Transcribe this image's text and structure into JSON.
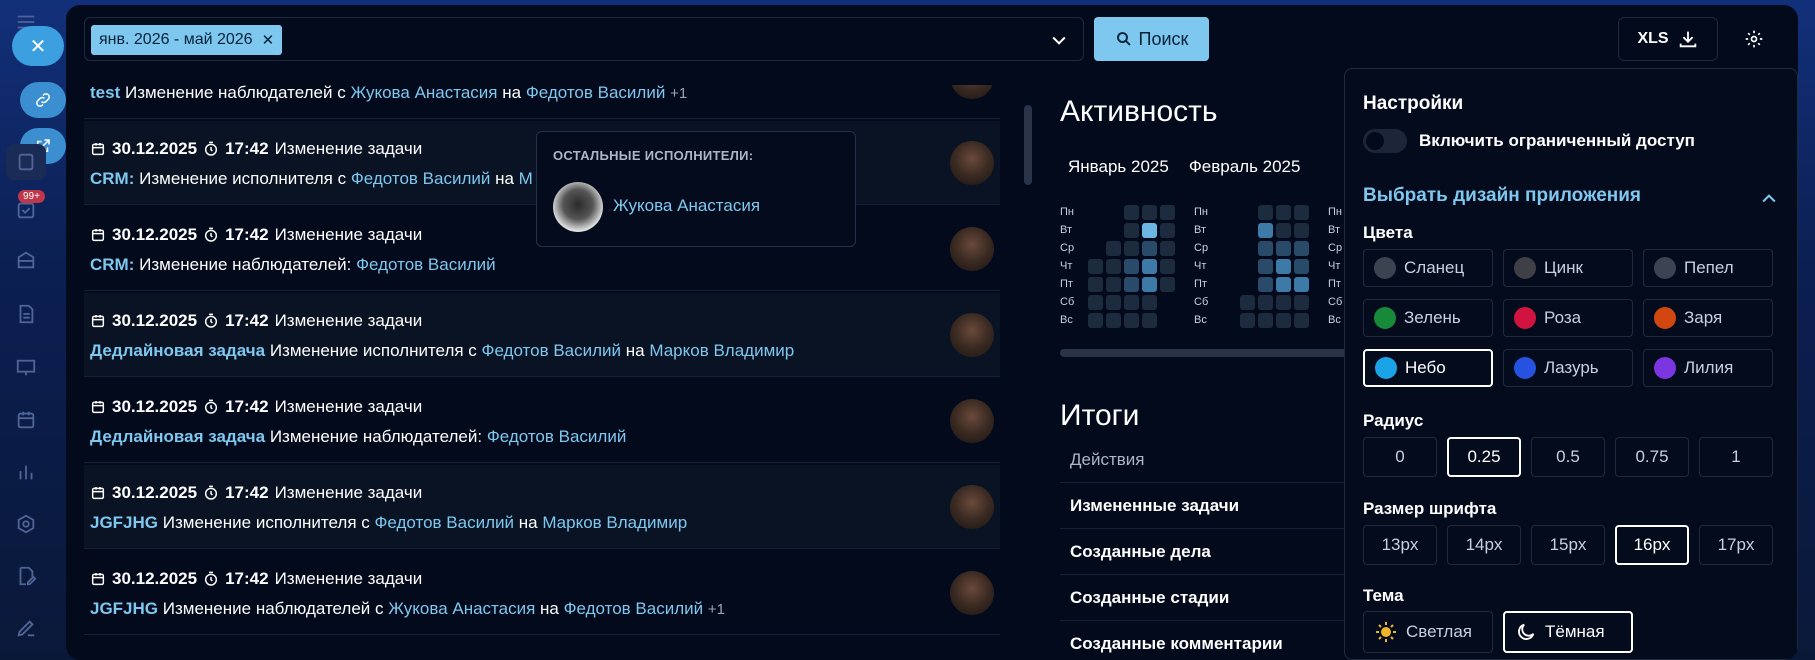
{
  "filter": {
    "chip_label": "янв. 2026 - май 2026",
    "search_label": "Поиск",
    "xls_label": "XLS"
  },
  "rail": {
    "badge": "99+"
  },
  "feed": [
    {
      "date": "30.12.2025",
      "time": "17:42",
      "action": "Изменение задачи",
      "task": "test",
      "desc": "Изменение наблюдателей с",
      "from": "Жукова Анастасия",
      "mid": "на",
      "to": "Федотов Василий",
      "extra": "+1"
    },
    {
      "date": "30.12.2025",
      "time": "17:42",
      "action": "Изменение задачи",
      "task": "CRM:",
      "desc": "Изменение исполнителя с",
      "from": "Федотов Василий",
      "mid": "на",
      "to": "М",
      "extra": ""
    },
    {
      "date": "30.12.2025",
      "time": "17:42",
      "action": "Изменение задачи",
      "task": "CRM:",
      "desc": "Изменение наблюдателей:",
      "from": "Федотов Василий",
      "mid": "",
      "to": "",
      "extra": ""
    },
    {
      "date": "30.12.2025",
      "time": "17:42",
      "action": "Изменение задачи",
      "task": "Дедлайновая задача",
      "desc": "Изменение исполнителя с",
      "from": "Федотов Василий",
      "mid": "на",
      "to": "Марков Владимир",
      "extra": ""
    },
    {
      "date": "30.12.2025",
      "time": "17:42",
      "action": "Изменение задачи",
      "task": "Дедлайновая задача",
      "desc": "Изменение наблюдателей:",
      "from": "Федотов Василий",
      "mid": "",
      "to": "",
      "extra": ""
    },
    {
      "date": "30.12.2025",
      "time": "17:42",
      "action": "Изменение задачи",
      "task": "JGFJHG",
      "desc": "Изменение исполнителя с",
      "from": "Федотов Василий",
      "mid": "на",
      "to": "Марков Владимир",
      "extra": ""
    },
    {
      "date": "30.12.2025",
      "time": "17:42",
      "action": "Изменение задачи",
      "task": "JGFJHG",
      "desc": "Изменение наблюдателей с",
      "from": "Жукова Анастасия",
      "mid": "на",
      "to": "Федотов Василий",
      "extra": "+1"
    }
  ],
  "popup": {
    "title": "ОСТАЛЬНЫЕ ИСПОЛНИТЕЛИ:",
    "name": "Жукова Анастасия"
  },
  "activity": {
    "title": "Активность",
    "months": [
      "Январь 2025",
      "Февраль 2025"
    ],
    "days": [
      "Пн",
      "Вт",
      "Ср",
      "Чт",
      "Пт",
      "Сб",
      "Вс"
    ],
    "days_cut": [
      "Пн",
      "Вт",
      "Ср",
      "Чт",
      "Пт",
      "Сб",
      "Вс"
    ]
  },
  "itogi": {
    "title": "Итоги",
    "header": "Действия",
    "rows": [
      "Измененные задачи",
      "Созданные дела",
      "Созданные стадии",
      "Созданные комментарии"
    ]
  },
  "settings": {
    "title": "Настройки",
    "toggle_label": "Включить ограниченный доступ",
    "design_label": "Выбрать дизайн приложения",
    "colors_label": "Цвета",
    "colors": [
      {
        "name": "Сланец",
        "hex": "#3b4250"
      },
      {
        "name": "Цинк",
        "hex": "#3f3f46"
      },
      {
        "name": "Пепел",
        "hex": "#3c4453"
      },
      {
        "name": "Зелень",
        "hex": "#178a3a"
      },
      {
        "name": "Роза",
        "hex": "#d0143f"
      },
      {
        "name": "Заря",
        "hex": "#d2470f"
      },
      {
        "name": "Небо",
        "hex": "#1ba3e8"
      },
      {
        "name": "Лазурь",
        "hex": "#2553e0"
      },
      {
        "name": "Лилия",
        "hex": "#7b36e2"
      }
    ],
    "selected_color": "Небо",
    "radius_label": "Радиус",
    "radius": [
      "0",
      "0.25",
      "0.5",
      "0.75",
      "1"
    ],
    "selected_radius": "0.25",
    "font_label": "Размер шрифта",
    "fonts": [
      "13px",
      "14px",
      "15px",
      "16px",
      "17px"
    ],
    "selected_font": "16px",
    "theme_label": "Тема",
    "theme_light": "Светлая",
    "theme_dark": "Тёмная",
    "selected_theme": "Тёмная"
  }
}
